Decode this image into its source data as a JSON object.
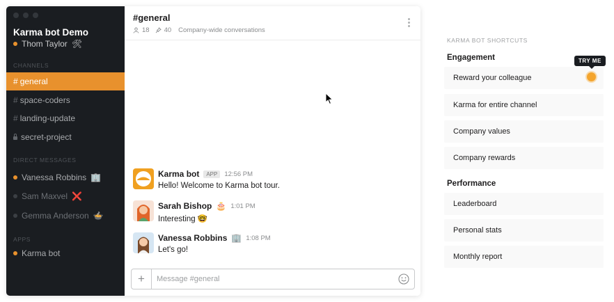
{
  "sidebar": {
    "team_name": "Karma bot Demo",
    "user_name": "Thom Taylor",
    "user_emoji": "🛠",
    "channels_title": "CHANNELS",
    "channels": [
      {
        "label": "general",
        "prefix": "#"
      },
      {
        "label": "space-coders",
        "prefix": "#"
      },
      {
        "label": "landing-update",
        "prefix": "#"
      },
      {
        "label": "secret-project",
        "prefix": "lock"
      }
    ],
    "dm_title": "DIRECT MESSAGES",
    "dms": [
      {
        "label": "Vanessa Robbins",
        "emoji": "🏢",
        "status": "online"
      },
      {
        "label": "Sam Maxvel",
        "emoji": "❌",
        "status": "away"
      },
      {
        "label": "Gemma Anderson",
        "emoji": "🍲",
        "status": "away"
      }
    ],
    "apps_title": "APPS",
    "apps": [
      {
        "label": "Karma bot",
        "status": "online"
      }
    ]
  },
  "channel": {
    "title": "#general",
    "members": "18",
    "pins": "40",
    "description": "Company-wide conversations"
  },
  "messages": [
    {
      "name": "Karma bot",
      "badge": "APP",
      "time": "12:56 PM",
      "text": "Hello! Welcome to Karma bot tour.",
      "emoji": ""
    },
    {
      "name": "Sarah Bishop",
      "badge": "",
      "time": "1:01 PM",
      "text": "Interesting 🤓",
      "emoji": "🎂"
    },
    {
      "name": "Vanessa Robbins",
      "badge": "",
      "time": "1:08 PM",
      "text": "Let's go!",
      "emoji": "🏢"
    }
  ],
  "composer": {
    "placeholder": "Message #general"
  },
  "shortcuts": {
    "title": "KARMA BOT SHORTCUTS",
    "try_me": "TRY ME",
    "engagement_title": "Engagement",
    "engagement": [
      "Reward your colleague",
      "Karma for entire channel",
      "Company values",
      "Company rewards"
    ],
    "performance_title": "Performance",
    "performance": [
      "Leaderboard",
      "Personal stats",
      "Monthly report"
    ]
  },
  "colors": {
    "sidebar_bg": "#1a1d21",
    "accent": "#e8912d"
  }
}
